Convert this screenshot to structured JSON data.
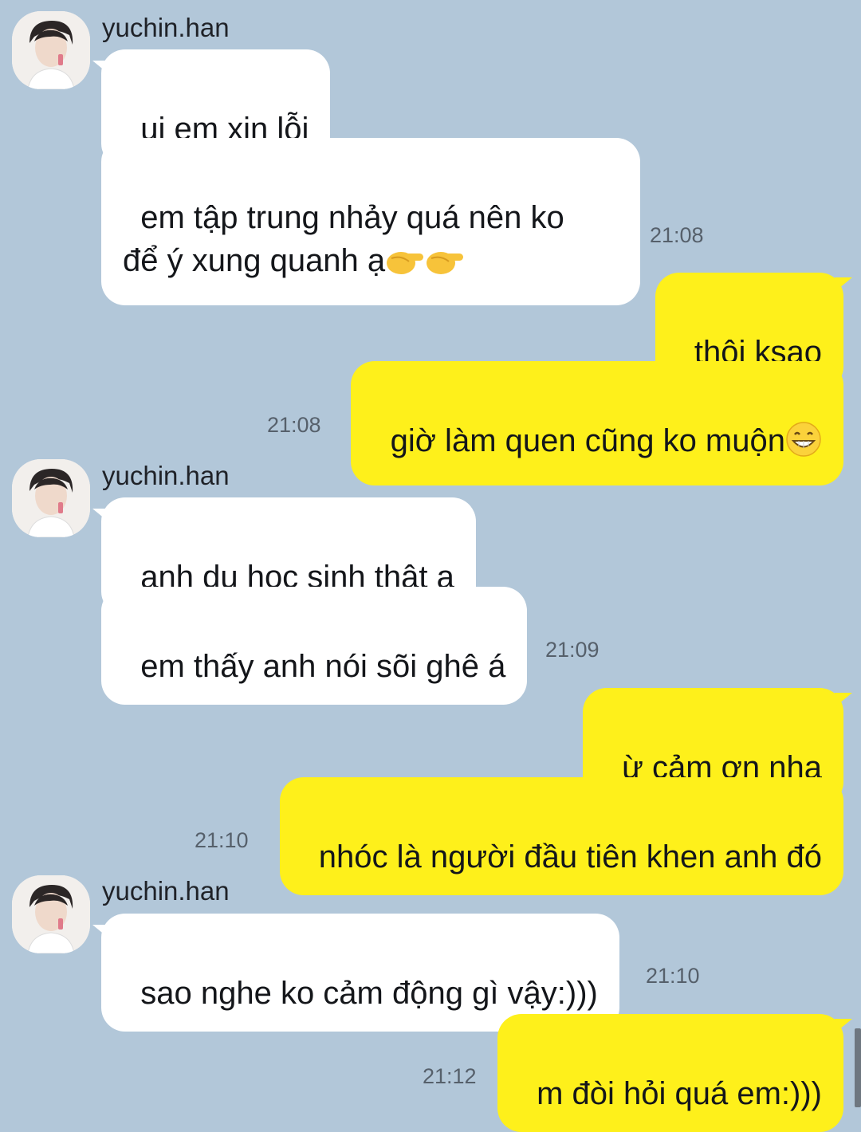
{
  "messages": [
    {
      "sender": "yuchin.han",
      "text": "ui em xin lỗi"
    },
    {
      "text": "em tập trung nhảy quá nên ko\nđể ý xung quanh ạ",
      "emoji": "pointing-right-hands-emoji",
      "time": "21:08"
    },
    {
      "text": "thôi ksao"
    },
    {
      "text": "giờ làm quen cũng ko muộn",
      "emoji": "grinning-face-emoji",
      "time": "21:08"
    },
    {
      "sender": "yuchin.han",
      "text": "anh du học sinh thật ạ"
    },
    {
      "text": "em thấy anh nói sõi ghê á",
      "time": "21:09"
    },
    {
      "text": "ừ cảm ơn nha"
    },
    {
      "text": "nhóc là người đầu tiên khen anh đó",
      "time": "21:10"
    },
    {
      "sender": "yuchin.han",
      "text": "sao nghe ko cảm động gì vậy:)))",
      "time": "21:10"
    },
    {
      "text": "m đòi hỏi quá em:)))",
      "time": "21:12"
    }
  ],
  "colors": {
    "background": "#b2c7d9",
    "incoming_bubble": "#ffffff",
    "outgoing_bubble": "#fef01b"
  }
}
